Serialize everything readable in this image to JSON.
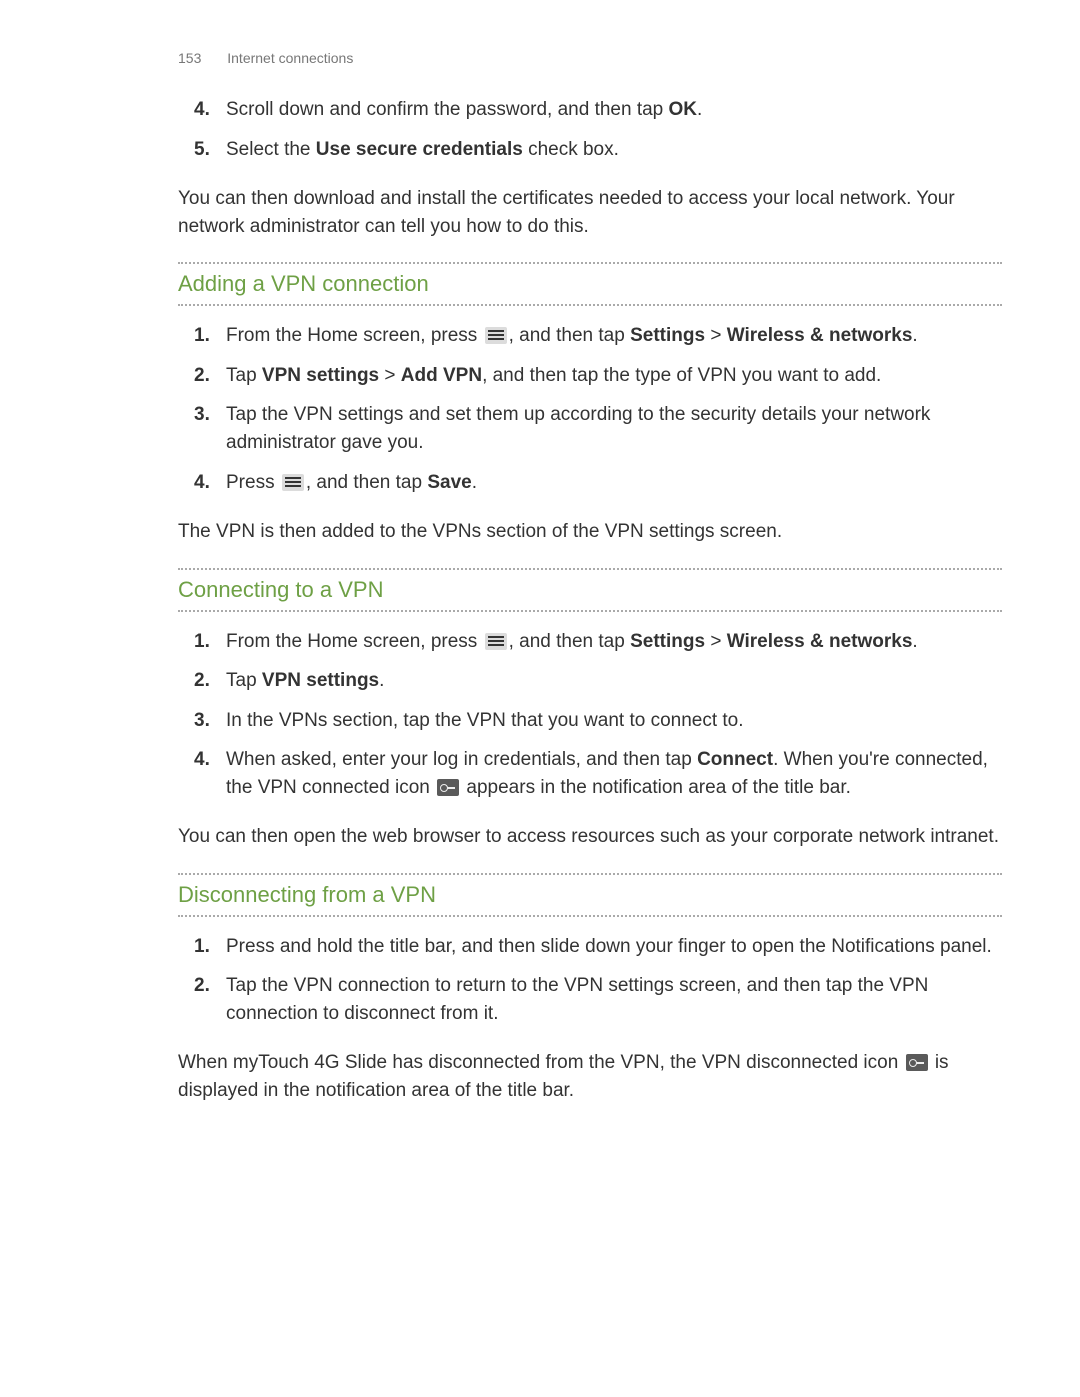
{
  "header": {
    "page_number": "153",
    "section": "Internet connections"
  },
  "intro_steps": [
    {
      "num": "4",
      "pre": "Scroll down and confirm the password, and then tap ",
      "bold1": "OK",
      "post": "."
    },
    {
      "num": "5",
      "pre": "Select the ",
      "bold1": "Use secure credentials",
      "post": " check box."
    }
  ],
  "intro_para": "You can then download and install the certificates needed to access your local network. Your network administrator can tell you how to do this.",
  "sections": {
    "adding": {
      "title": "Adding a VPN connection",
      "steps": {
        "s1": {
          "num": "1",
          "t1": "From the Home screen, press ",
          "t2": ", and then tap ",
          "b1": "Settings",
          "t3": " > ",
          "b2": "Wireless & networks",
          "t4": "."
        },
        "s2": {
          "num": "2",
          "t1": "Tap ",
          "b1": "VPN settings",
          "t2": " > ",
          "b2": "Add VPN",
          "t3": ", and then tap the type of VPN you want to add."
        },
        "s3": {
          "num": "3",
          "t1": "Tap the VPN settings and set them up according to the security details your network administrator gave you."
        },
        "s4": {
          "num": "4",
          "t1": "Press ",
          "t2": ", and then tap ",
          "b1": "Save",
          "t3": "."
        }
      },
      "after": "The VPN is then added to the VPNs section of the VPN settings screen."
    },
    "connecting": {
      "title": "Connecting to a VPN",
      "steps": {
        "s1": {
          "num": "1",
          "t1": "From the Home screen, press ",
          "t2": ", and then tap ",
          "b1": "Settings",
          "t3": " > ",
          "b2": "Wireless & networks",
          "t4": "."
        },
        "s2": {
          "num": "2",
          "t1": "Tap ",
          "b1": "VPN settings",
          "t2": "."
        },
        "s3": {
          "num": "3",
          "t1": "In the VPNs section, tap the VPN that you want to connect to."
        },
        "s4": {
          "num": "4",
          "t1": "When asked, enter your log in credentials, and then tap ",
          "b1": "Connect",
          "t2": ". When you're connected, the VPN connected icon ",
          "t3": " appears in the notification area of the title bar."
        }
      },
      "after": "You can then open the web browser to access resources such as your corporate network intranet."
    },
    "disconnecting": {
      "title": "Disconnecting from a VPN",
      "steps": {
        "s1": {
          "num": "1",
          "t1": "Press and hold the title bar, and then slide down your finger to open the Notifications panel."
        },
        "s2": {
          "num": "2",
          "t1": "Tap the VPN connection to return to the VPN settings screen, and then tap the VPN connection to disconnect from it."
        }
      },
      "after_pre": "When myTouch 4G Slide has disconnected from the VPN, the VPN disconnected icon ",
      "after_post": " is displayed in the notification area of the title bar."
    }
  }
}
